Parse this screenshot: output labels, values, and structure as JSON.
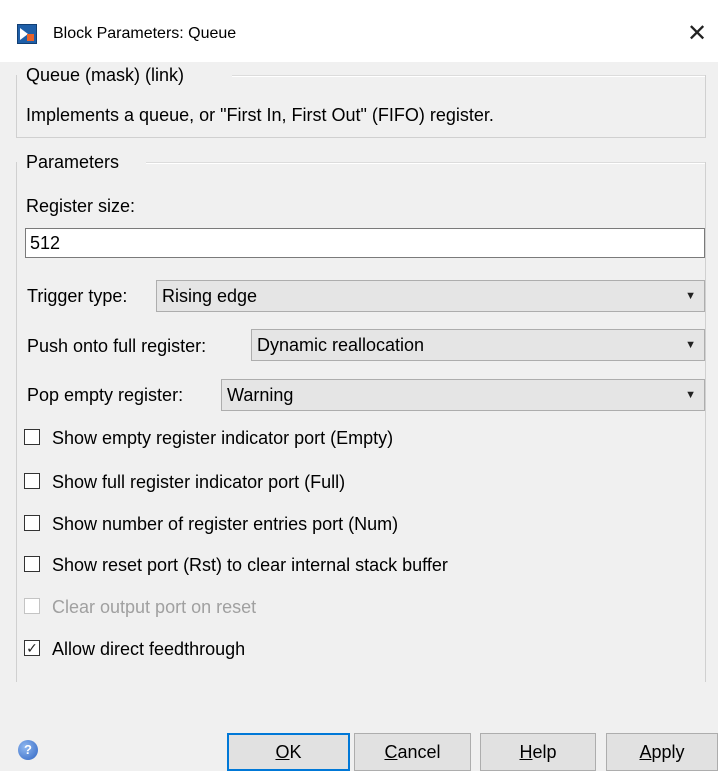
{
  "window": {
    "title": "Block Parameters: Queue",
    "close_glyph": "✕"
  },
  "description_group": {
    "header": "Queue (mask) (link)",
    "text": "Implements a queue, or \"First In, First Out\" (FIFO) register."
  },
  "parameters": {
    "header": "Parameters",
    "register_size": {
      "label": "Register size:",
      "value": "512"
    },
    "trigger_type": {
      "label": "Trigger type:",
      "value": "Rising edge"
    },
    "push_full": {
      "label": "Push onto full register:",
      "value": "Dynamic reallocation"
    },
    "pop_empty": {
      "label": "Pop empty register:",
      "value": "Warning"
    },
    "checkboxes": [
      {
        "label": "Show empty register indicator port (Empty)",
        "checked": false,
        "enabled": true
      },
      {
        "label": "Show full register indicator port (Full)",
        "checked": false,
        "enabled": true
      },
      {
        "label": "Show number of register entries port (Num)",
        "checked": false,
        "enabled": true
      },
      {
        "label": "Show reset port (Rst) to clear internal stack buffer",
        "checked": false,
        "enabled": true
      },
      {
        "label": "Clear output port on reset",
        "checked": false,
        "enabled": false
      },
      {
        "label": "Allow direct feedthrough",
        "checked": true,
        "enabled": true
      }
    ]
  },
  "buttons": {
    "ok": {
      "mnemonic": "O",
      "rest": "K"
    },
    "cancel": {
      "mnemonic": "C",
      "rest": "ancel"
    },
    "help": {
      "mnemonic": "H",
      "rest": "elp"
    },
    "apply": {
      "mnemonic": "A",
      "rest": "pply"
    }
  },
  "icons": {
    "app": "simulink-block-icon",
    "help": "help-question-icon",
    "close": "close-icon",
    "dropdown": "chevron-down-icon",
    "checkmark": "✓",
    "help_glyph": "?"
  },
  "colors": {
    "window_bg": "#f0f0f0",
    "titlebar_bg": "#ffffff",
    "default_button_border": "#0078d7",
    "disabled_text": "#a0a0a0"
  }
}
